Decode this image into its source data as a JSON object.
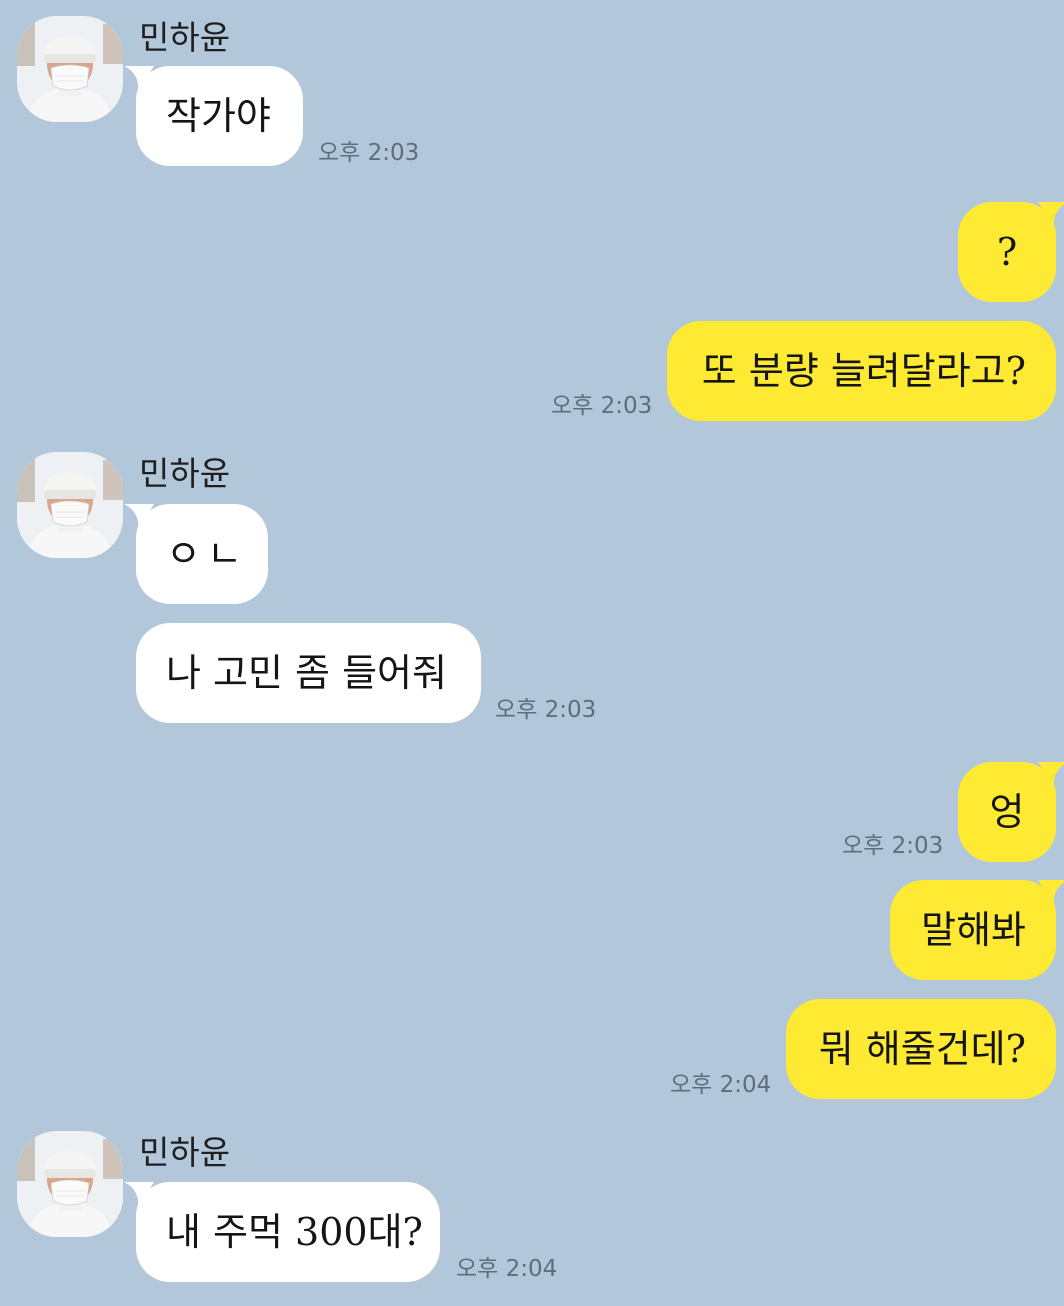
{
  "chat": {
    "partner_name": "민하윤",
    "groups": [
      {
        "sender": "민하윤",
        "messages": [
          "작가야"
        ],
        "time": "오후 2:03"
      },
      {
        "sender": "me",
        "messages": [
          "?",
          "또 분량 늘려달라고?"
        ],
        "time": "오후 2:03"
      },
      {
        "sender": "민하윤",
        "messages": [
          "ㅇㄴ",
          "나 고민 좀 들어줘"
        ],
        "time": "오후 2:03"
      },
      {
        "sender": "me",
        "messages": [
          "엉"
        ],
        "time": "오후 2:03"
      },
      {
        "sender": "me",
        "messages": [
          "말해봐",
          "뭐 해줄건데?"
        ],
        "time": "오후 2:04"
      },
      {
        "sender": "민하윤",
        "messages": [
          "내 주먹 300대?"
        ],
        "time": "오후 2:04"
      }
    ]
  },
  "colors": {
    "background": "#b2c7da",
    "incoming_bubble": "#ffffff",
    "outgoing_bubble": "#fee933",
    "timestamp": "#5f6e7d"
  },
  "icons": {
    "avatar": "profile-photo-person-with-white-beanie-and-mask"
  }
}
